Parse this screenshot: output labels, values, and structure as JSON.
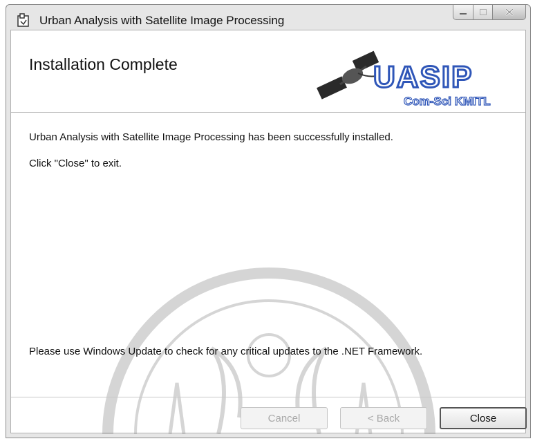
{
  "window": {
    "title": "Urban Analysis with Satellite Image Processing",
    "app_icon": "installer-icon",
    "controls": {
      "minimize": "minimize-icon",
      "maximize": "maximize-icon",
      "close": "close-icon"
    }
  },
  "header": {
    "title": "Installation Complete",
    "logo": {
      "main_text": "UASIP",
      "sub_text": "Com-Sci KMITL"
    }
  },
  "body": {
    "message1": "Urban Analysis with Satellite Image Processing has been successfully installed.",
    "message2": "Click \"Close\" to exit.",
    "update_note": "Please use Windows Update to check for any critical updates to the .NET Framework."
  },
  "buttons": {
    "cancel": {
      "label": "Cancel",
      "enabled": false
    },
    "back": {
      "label": "< Back",
      "enabled": false
    },
    "close": {
      "label": "Close",
      "enabled": true
    }
  },
  "colors": {
    "logo_blue": "#2f56b8",
    "text": "#111111",
    "disabled_text": "#a8a8a8"
  }
}
